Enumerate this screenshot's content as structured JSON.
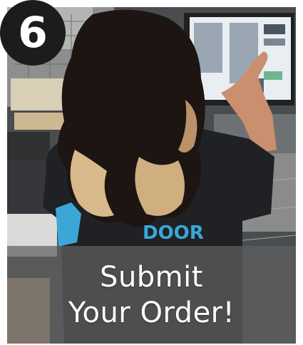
{
  "badge": {
    "number": "6"
  },
  "caption": {
    "line1": "Submit",
    "line2": "Your Order!"
  },
  "shirt_logo": {
    "text": "DOOR"
  },
  "colors": {
    "badge_bg": "#1c1c1e",
    "caption_overlay": "#5f5f5f",
    "logo_accent": "#3aa7d6"
  }
}
